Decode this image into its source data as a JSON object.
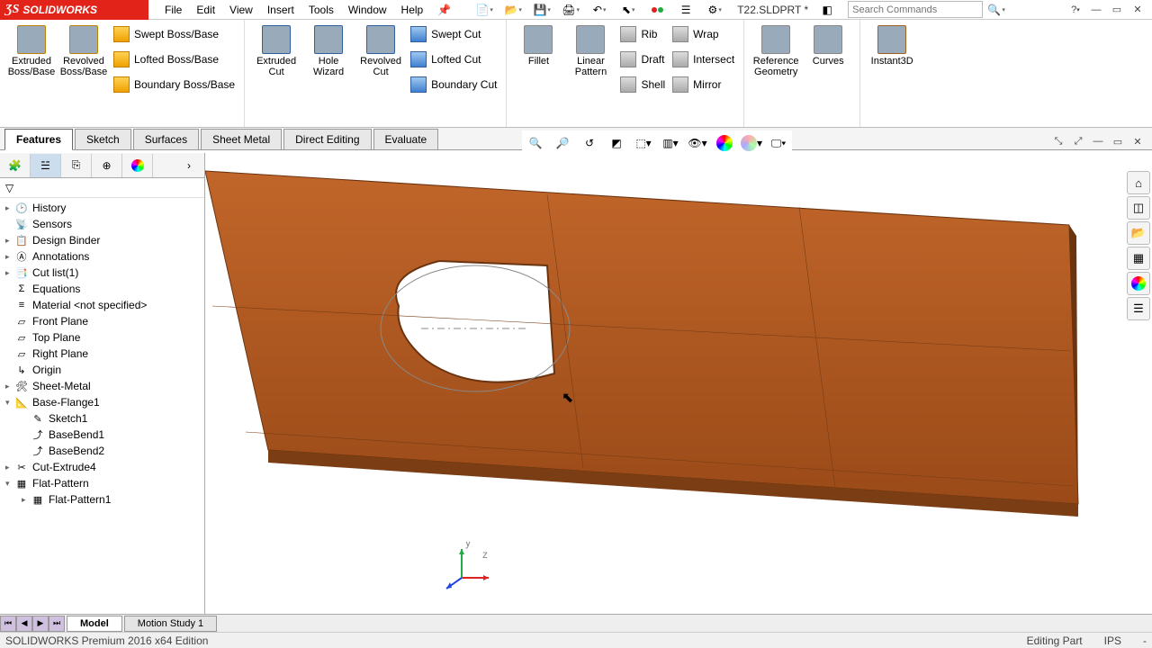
{
  "app": {
    "name": "SOLIDWORKS",
    "menus": [
      "File",
      "Edit",
      "View",
      "Insert",
      "Tools",
      "Window",
      "Help"
    ],
    "docname": "T22.SLDPRT *",
    "search_placeholder": "Search Commands"
  },
  "ribbon": {
    "extruded_boss": "Extruded Boss/Base",
    "revolved_boss": "Revolved Boss/Base",
    "swept_boss": "Swept Boss/Base",
    "lofted_boss": "Lofted Boss/Base",
    "boundary_boss": "Boundary Boss/Base",
    "extruded_cut": "Extruded Cut",
    "hole_wizard": "Hole Wizard",
    "revolved_cut": "Revolved Cut",
    "swept_cut": "Swept Cut",
    "lofted_cut": "Lofted Cut",
    "boundary_cut": "Boundary Cut",
    "fillet": "Fillet",
    "linear_pattern": "Linear Pattern",
    "rib": "Rib",
    "draft": "Draft",
    "shell": "Shell",
    "wrap": "Wrap",
    "intersect": "Intersect",
    "mirror": "Mirror",
    "ref_geom": "Reference Geometry",
    "curves": "Curves",
    "instant3d": "Instant3D"
  },
  "command_tabs": [
    "Features",
    "Sketch",
    "Surfaces",
    "Sheet Metal",
    "Direct Editing",
    "Evaluate"
  ],
  "tree": {
    "history": "History",
    "sensors": "Sensors",
    "design_binder": "Design Binder",
    "annotations": "Annotations",
    "cut_list": "Cut list(1)",
    "equations": "Equations",
    "material": "Material <not specified>",
    "front": "Front Plane",
    "top": "Top Plane",
    "right": "Right Plane",
    "origin": "Origin",
    "sheet_metal": "Sheet-Metal",
    "base_flange": "Base-Flange1",
    "sketch1": "Sketch1",
    "basebend1": "BaseBend1",
    "basebend2": "BaseBend2",
    "cut_extrude": "Cut-Extrude4",
    "flat_pattern": "Flat-Pattern",
    "flat_pattern1": "Flat-Pattern1"
  },
  "bottom": {
    "model": "Model",
    "motion": "Motion Study 1"
  },
  "status": {
    "edition": "SOLIDWORKS Premium 2016 x64 Edition",
    "mode": "Editing Part",
    "units": "IPS",
    "custom": "-"
  }
}
